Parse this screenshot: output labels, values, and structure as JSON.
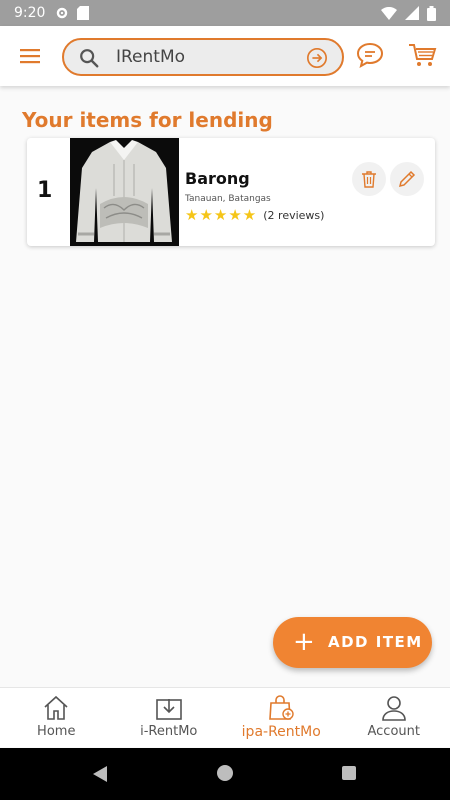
{
  "status_bar": {
    "time": "9:20",
    "left_icons": [
      "settings-icon",
      "sd-card-icon"
    ],
    "right_icons": [
      "wifi-icon",
      "signal-icon",
      "battery-icon"
    ]
  },
  "app_bar": {
    "search_value": "IRentMo",
    "icons": [
      "menu-icon",
      "search-icon",
      "arrow-right-circle-icon",
      "chat-icon",
      "cart-icon"
    ],
    "accent_color": "#e07a2d"
  },
  "section": {
    "title": "Your items for lending"
  },
  "items": [
    {
      "index": "1",
      "name": "Barong",
      "location": "Tanauan, Batangas",
      "rating": 5,
      "stars": "★★★★★",
      "reviews": "(2 reviews)"
    }
  ],
  "fab": {
    "plus": "+",
    "label": "ADD ITEM",
    "color": "#f08432"
  },
  "bottom_nav": {
    "items": [
      {
        "label": "Home",
        "icon": "house-icon"
      },
      {
        "label": "i-RentMo",
        "icon": "box-icon"
      },
      {
        "label": "ipa-RentMo",
        "icon": "bag-icon",
        "active": true
      },
      {
        "label": "Account",
        "icon": "person-icon"
      }
    ]
  }
}
